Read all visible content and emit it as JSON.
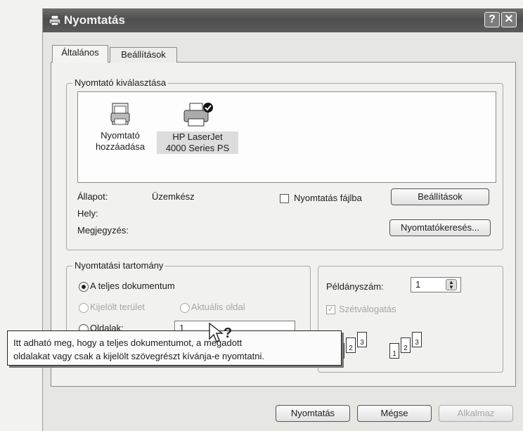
{
  "window": {
    "title": "Nyomtatás",
    "help_symbol": "?",
    "close_symbol": "✕"
  },
  "tabs": [
    {
      "label": "Általános"
    },
    {
      "label": "Beállítások"
    }
  ],
  "printer_group": {
    "label": "Nyomtató kiválasztása",
    "items": [
      {
        "line1": "Nyomtató",
        "line2": "hozzáadása",
        "icon": "add-printer-icon"
      },
      {
        "line1": "HP LaserJet",
        "line2": "4000 Series PS",
        "icon": "printer-icon",
        "selected": true
      }
    ],
    "status_label": "Állapot:",
    "status_value": "Üzemkész",
    "location_label": "Hely:",
    "comment_label": "Megjegyzés:",
    "print_to_file_label": "Nyomtatás fájlba",
    "preferences_button": "Beállítások",
    "find_printer_button": "Nyomtatókeresés..."
  },
  "range_group": {
    "label": "Nyomtatási tartomány",
    "all_label": "A teljes dokumentum",
    "selection_label": "Kijelölt terület",
    "current_page_label": "Aktuális oldal",
    "pages_label": "Oldalak:",
    "pages_value": "1"
  },
  "copies_group": {
    "copies_label": "Példányszám:",
    "copies_value": "1",
    "collate_label": "Szétválogatás",
    "page_numbers": [
      "1",
      "2",
      "3"
    ]
  },
  "tooltip": {
    "line1": "Itt adható meg, hogy a teljes dokumentumot, a megadott",
    "line2": "oldalakat vagy csak a kijelölt szövegrészt kívánja-e nyomtatni."
  },
  "buttons": {
    "print": "Nyomtatás",
    "cancel": "Mégse",
    "apply": "Alkalmaz"
  }
}
